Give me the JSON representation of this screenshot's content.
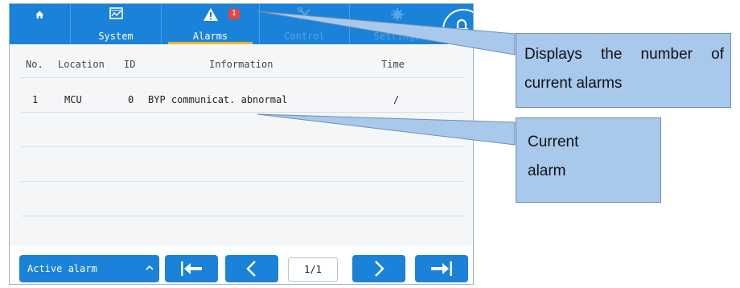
{
  "tabs": [
    {
      "label": "",
      "icon": "home-icon"
    },
    {
      "label": "System",
      "icon": "monitor-chart-icon"
    },
    {
      "label": "Alarms",
      "icon": "warning-icon",
      "badge": "1"
    },
    {
      "label": "Control",
      "icon": "tools-icon"
    },
    {
      "label": "Settings",
      "icon": "gear-icon"
    }
  ],
  "lock_icon": "lock-icon",
  "table": {
    "headers": [
      "No.",
      "Location",
      "ID",
      "Information",
      "Time"
    ],
    "rows": [
      [
        "1",
        "MCU",
        "0",
        "BYP communicat. abnormal",
        "/"
      ]
    ]
  },
  "footer": {
    "filter_label": "Active alarm",
    "filter_icon": "chevron-up-icon",
    "first_icon": "first-page-icon",
    "prev_icon": "prev-page-icon",
    "page_indicator": "1/1",
    "next_icon": "next-page-icon",
    "last_icon": "last-page-icon"
  },
  "callouts": [
    {
      "text": "Displays the number of current alarms"
    },
    {
      "text": "Current alarm"
    }
  ],
  "colors": {
    "accent": "#1a82d8",
    "badge": "#e94545",
    "underline": "#f0b428",
    "callout": "#a8c8ec"
  }
}
